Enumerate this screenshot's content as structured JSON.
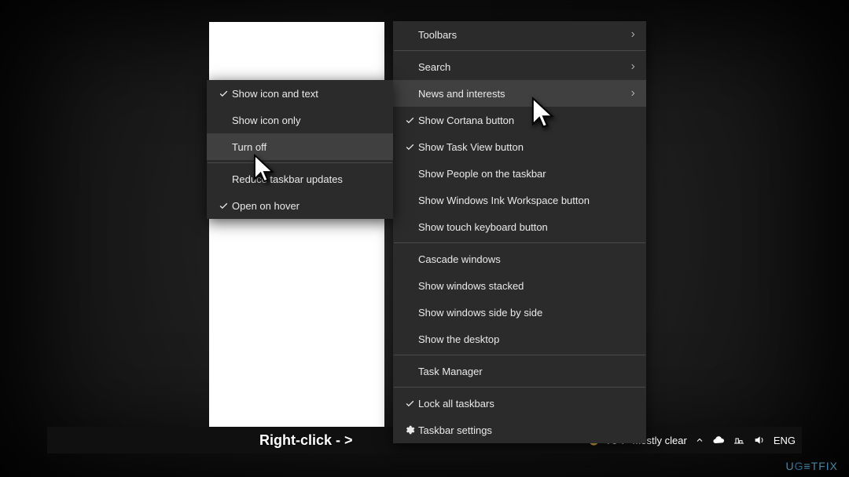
{
  "submenu": {
    "items": [
      {
        "label": "Show icon and text",
        "checked": true,
        "hover": false
      },
      {
        "label": "Show icon only",
        "checked": false,
        "hover": false
      },
      {
        "label": "Turn off",
        "checked": false,
        "hover": true
      }
    ],
    "after_sep": [
      {
        "label": "Reduce taskbar updates",
        "checked": false
      },
      {
        "label": "Open on hover",
        "checked": true
      }
    ]
  },
  "mainmenu": {
    "groups": [
      [
        {
          "label": "Toolbars",
          "submenu_arrow": true
        }
      ],
      [
        {
          "label": "Search",
          "submenu_arrow": true
        },
        {
          "label": "News and interests",
          "submenu_arrow": true,
          "hover": true
        },
        {
          "label": "Show Cortana button",
          "checked": true
        },
        {
          "label": "Show Task View button",
          "checked": true
        },
        {
          "label": "Show People on the taskbar"
        },
        {
          "label": "Show Windows Ink Workspace button"
        },
        {
          "label": "Show touch keyboard button"
        }
      ],
      [
        {
          "label": "Cascade windows"
        },
        {
          "label": "Show windows stacked"
        },
        {
          "label": "Show windows side by side"
        },
        {
          "label": "Show the desktop"
        }
      ],
      [
        {
          "label": "Task Manager"
        }
      ],
      [
        {
          "label": "Lock all taskbars",
          "checked": true
        },
        {
          "label": "Taskbar settings",
          "icon": "gear"
        }
      ]
    ]
  },
  "taskbar": {
    "instruction": "Right-click - >",
    "weather": {
      "temp": "70°F",
      "condition": "Mostly clear"
    },
    "tray_icons": [
      "chevron-up",
      "onedrive-cloud",
      "network",
      "volume"
    ],
    "lang": "ENG"
  },
  "watermark": "UG≣TFIX"
}
